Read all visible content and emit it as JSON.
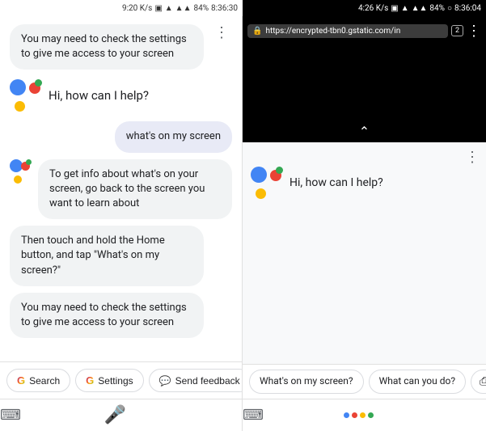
{
  "left_status": {
    "speed": "9:20 K/s",
    "network": "VoLTE",
    "battery": "84%",
    "time": "8:36:30"
  },
  "right_status": {
    "speed": "4:26 K/s",
    "network": "VoLTE",
    "battery": "84%",
    "time": "8:36:04"
  },
  "chat": {
    "bubble1": "You may need to check the settings to give me access to your screen",
    "greeting": "Hi, how can I help?",
    "user_msg": "what's on my screen",
    "response1": "To get info about what's on your screen, go back to the screen you want to learn about",
    "response2": "Then touch and hold the Home button, and tap \"What's on my screen?\"",
    "response3": "You may need to check the settings to give me access to your screen"
  },
  "buttons": {
    "search": "Search",
    "settings": "Settings",
    "feedback": "Send feedback"
  },
  "browser": {
    "url": "https://encrypted-tbn0.gstatic.com/in",
    "tab_count": "2"
  },
  "right_panel": {
    "greeting": "Hi, how can I help?"
  },
  "suggestions": {
    "chip1": "What's on my screen?",
    "chip2": "What can you do?"
  }
}
